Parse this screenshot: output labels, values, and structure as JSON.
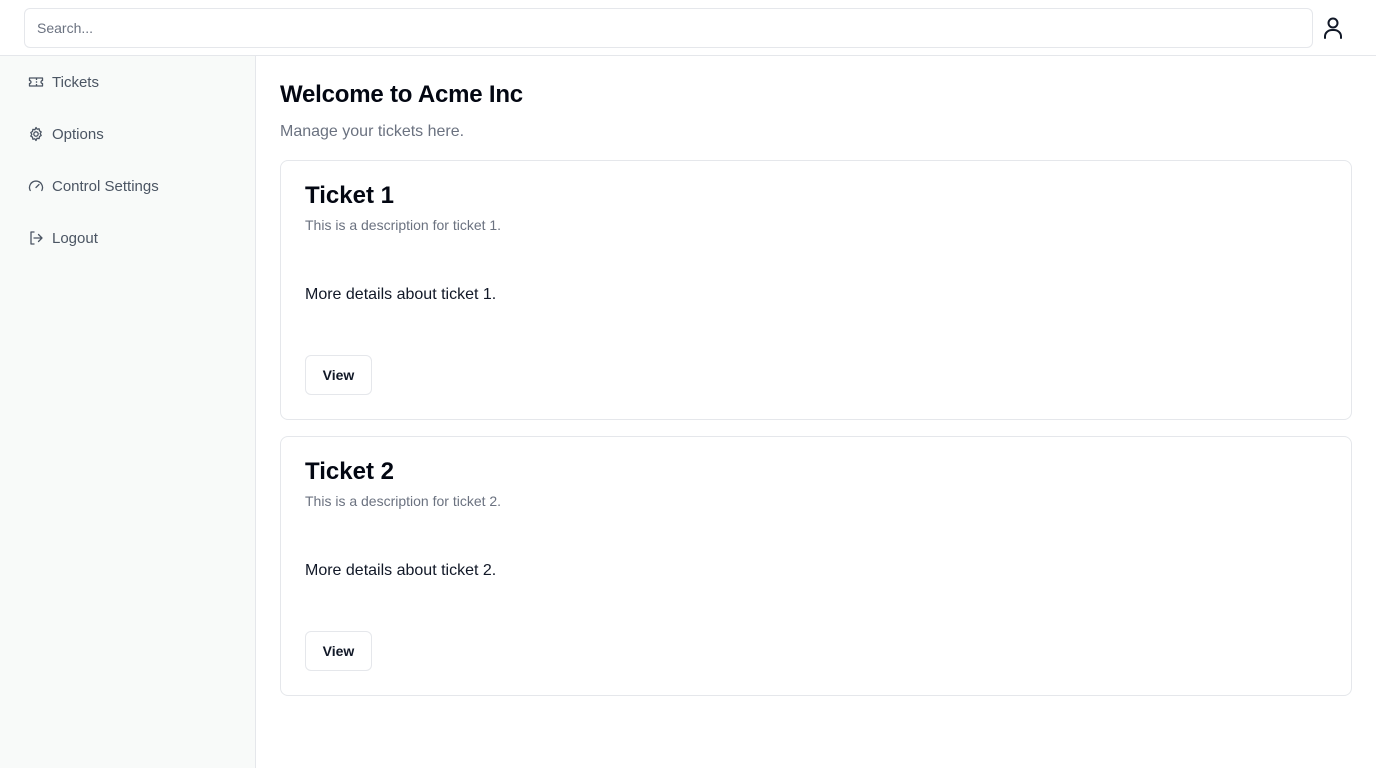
{
  "header": {
    "search_placeholder": "Search...",
    "user_icon": "user-icon"
  },
  "sidebar": {
    "items": [
      {
        "label": "Tickets",
        "icon": "ticket-icon"
      },
      {
        "label": "Options",
        "icon": "gear-icon"
      },
      {
        "label": "Control Settings",
        "icon": "gauge-icon"
      },
      {
        "label": "Logout",
        "icon": "logout-icon"
      }
    ]
  },
  "main": {
    "title": "Welcome to Acme Inc",
    "subtitle": "Manage your tickets here.",
    "tickets": [
      {
        "title": "Ticket 1",
        "description": "This is a description for ticket 1.",
        "details": "More details about ticket 1.",
        "button_label": "View"
      },
      {
        "title": "Ticket 2",
        "description": "This is a description for ticket 2.",
        "details": "More details about ticket 2.",
        "button_label": "View"
      }
    ]
  },
  "colors": {
    "sidebar_bg": "#f8faf9",
    "border": "#e5e7eb",
    "muted_text": "#6b7280",
    "heading": "#030712"
  }
}
